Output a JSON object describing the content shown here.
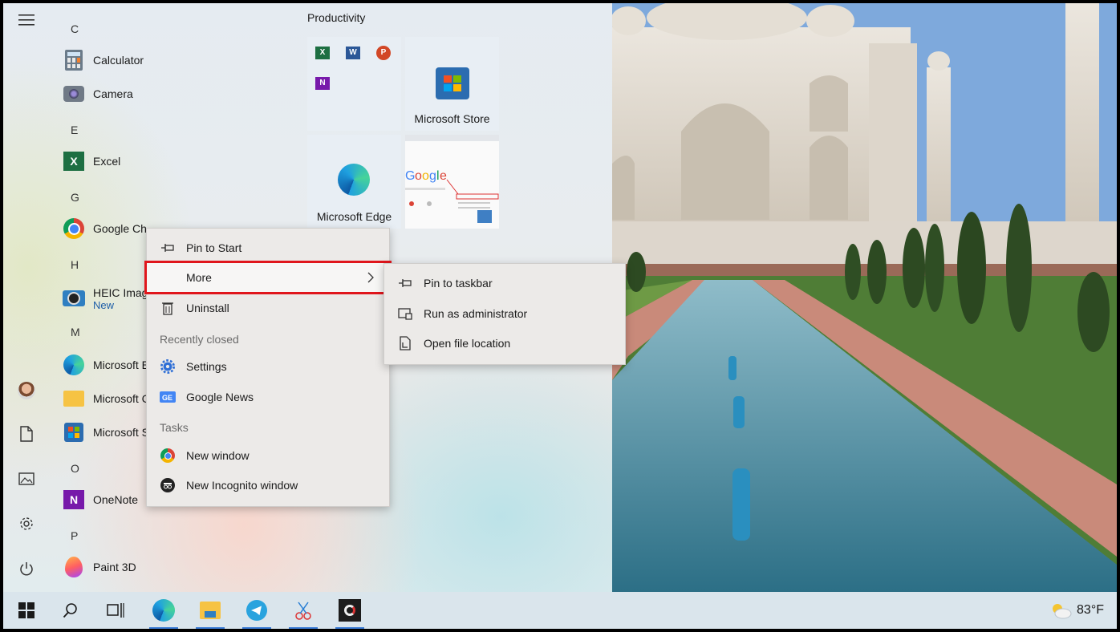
{
  "start_menu": {
    "letters": [
      "C",
      "E",
      "G",
      "H",
      "M",
      "O",
      "P"
    ],
    "apps": [
      {
        "name": "Calculator",
        "icon": "calculator-icon"
      },
      {
        "name": "Camera",
        "icon": "camera-icon"
      },
      {
        "name": "Excel",
        "icon": "excel-icon"
      },
      {
        "name": "Google Ch",
        "icon": "chrome-icon"
      },
      {
        "name": "HEIC Imag",
        "sub": "New",
        "icon": "heic-icon"
      },
      {
        "name": "Microsoft E",
        "icon": "edge-icon"
      },
      {
        "name": "Microsoft C",
        "icon": "folder-icon"
      },
      {
        "name": "Microsoft S",
        "icon": "store-icon"
      },
      {
        "name": "OneNote",
        "icon": "onenote-icon"
      },
      {
        "name": "Paint 3D",
        "icon": "paint3d-icon"
      }
    ],
    "group_title": "Productivity",
    "tiles": {
      "store": "Microsoft Store",
      "edge": "Microsoft Edge",
      "office_icons": [
        "X",
        "W",
        "P",
        "N"
      ]
    }
  },
  "context_menu": {
    "items": [
      {
        "label": "Pin to Start",
        "icon": "pin-icon"
      },
      {
        "label": "More",
        "icon": "",
        "has_submenu": true,
        "highlighted": true
      },
      {
        "label": "Uninstall",
        "icon": "trash-icon"
      }
    ],
    "recent_title": "Recently closed",
    "recent": [
      {
        "label": "Settings",
        "icon": "gear-icon"
      },
      {
        "label": "Google News",
        "icon": "google-news-icon"
      }
    ],
    "tasks_title": "Tasks",
    "tasks": [
      {
        "label": "New window",
        "icon": "chrome-icon"
      },
      {
        "label": "New Incognito window",
        "icon": "incognito-icon"
      }
    ]
  },
  "submenu": {
    "items": [
      {
        "label": "Pin to taskbar",
        "icon": "pin-icon"
      },
      {
        "label": "Run as administrator",
        "icon": "shield-icon"
      },
      {
        "label": "Open file location",
        "icon": "file-location-icon"
      }
    ]
  },
  "taskbar": {
    "weather": "83°F",
    "icons": [
      "windows-start-icon",
      "search-icon",
      "task-view-icon",
      "edge-icon",
      "file-explorer-icon",
      "telegram-icon",
      "snip-sketch-icon",
      "obs-icon"
    ]
  },
  "colors": {
    "highlight_border": "#e0161c",
    "accent": "#3a7bd5"
  }
}
